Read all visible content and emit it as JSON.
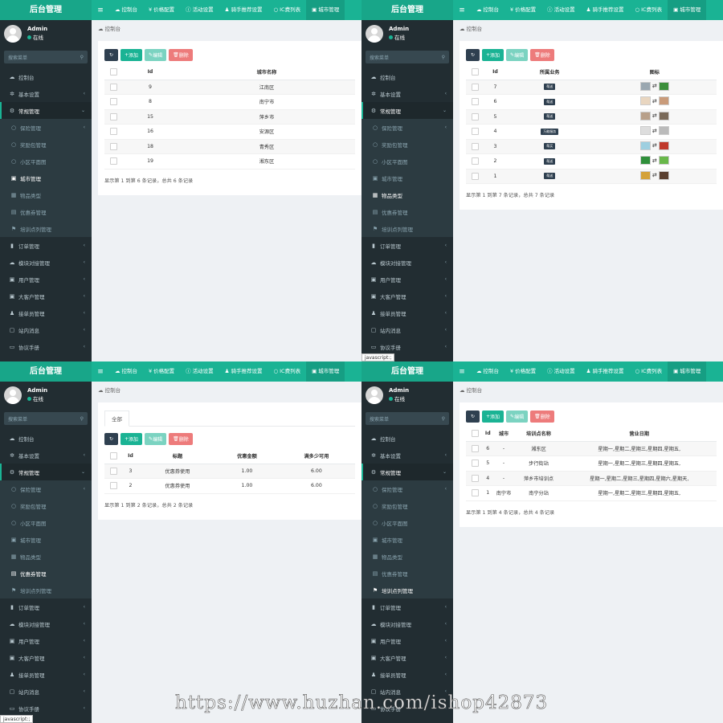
{
  "common": {
    "logo": "后台管理",
    "user_name": "Admin",
    "user_status": "在线",
    "search_placeholder": "搜索菜单",
    "breadcrumb": "控制台",
    "buttons": {
      "add": "添加",
      "edit": "编辑",
      "delete": "删除"
    },
    "status_text": "javascript:;",
    "top_tabs": [
      {
        "label": "控制台",
        "icon": "☁"
      },
      {
        "label": "价格配置",
        "icon": "¥"
      },
      {
        "label": "活动设置",
        "icon": "ⓘ"
      },
      {
        "label": "骑手推荐设置",
        "icon": "♟"
      },
      {
        "label": "IC费列表",
        "icon": "○"
      },
      {
        "label": "城市管理",
        "icon": "▣"
      }
    ],
    "menu": [
      {
        "label": "控制台",
        "icon": "☁",
        "arrow": ""
      },
      {
        "label": "基本设置",
        "icon": "✲",
        "arrow": "‹"
      },
      {
        "label": "常规管理",
        "icon": "⚙",
        "arrow": "⌄"
      },
      {
        "label": "保险管理",
        "icon": "○",
        "arrow": "‹"
      },
      {
        "label": "奖励包管理",
        "icon": "○",
        "arrow": ""
      },
      {
        "label": "小区平面图",
        "icon": "○",
        "arrow": ""
      },
      {
        "label": "城市管理",
        "icon": "▣",
        "arrow": ""
      },
      {
        "label": "物品类型",
        "icon": "▦",
        "arrow": ""
      },
      {
        "label": "优惠券管理",
        "icon": "▤",
        "arrow": ""
      },
      {
        "label": "培训点列管理",
        "icon": "⚑",
        "arrow": ""
      },
      {
        "label": "订单管理",
        "icon": "▮",
        "arrow": "‹"
      },
      {
        "label": "模块对接管理",
        "icon": "☁",
        "arrow": "‹"
      },
      {
        "label": "用户管理",
        "icon": "▣",
        "arrow": "‹"
      },
      {
        "label": "大客户管理",
        "icon": "▣",
        "arrow": "‹"
      },
      {
        "label": "接单员管理",
        "icon": "♟",
        "arrow": "‹"
      },
      {
        "label": "站内消息",
        "icon": "▢",
        "arrow": "‹"
      },
      {
        "label": "协议手册",
        "icon": "▭",
        "arrow": "‹"
      }
    ]
  },
  "screens": [
    {
      "active_menu": "城市管理",
      "columns": [
        "Id",
        "城市名称"
      ],
      "rows": [
        [
          "9",
          "江南区"
        ],
        [
          "8",
          "南宁市"
        ],
        [
          "15",
          "萍乡市"
        ],
        [
          "16",
          "安源区"
        ],
        [
          "18",
          "青秀区"
        ],
        [
          "19",
          "湘东区"
        ]
      ],
      "pager": "显示第 1 到第 6 条记录，总共 6 条记录"
    },
    {
      "active_menu": "物品类型",
      "columns": [
        "Id",
        "所属业务",
        "图标"
      ],
      "rows": [
        [
          "7",
          "帮送"
        ],
        [
          "6",
          "帮送"
        ],
        [
          "5",
          "帮送"
        ],
        [
          "4",
          "万能服务"
        ],
        [
          "3",
          "帮买"
        ],
        [
          "2",
          "帮送"
        ],
        [
          "1",
          "帮送"
        ]
      ],
      "pager": "显示第 1 到第 7 条记录，总共 7 条记录"
    },
    {
      "active_menu": "优惠券管理",
      "filter_tab": "全部",
      "columns": [
        "Id",
        "标题",
        "优惠金额",
        "满多少可用"
      ],
      "rows": [
        [
          "3",
          "优惠券使用",
          "1.00",
          "6.00"
        ],
        [
          "2",
          "优惠券使用",
          "1.00",
          "6.00"
        ]
      ],
      "pager": "显示第 1 到第 2 条记录，总共 2 条记录"
    },
    {
      "active_menu": "培训点列管理",
      "columns": [
        "Id",
        "城市",
        "培训点名称",
        "营业日期"
      ],
      "rows": [
        [
          "6",
          "-",
          "湘东区",
          "星期一,星期二,星期三,星期四,星期五,"
        ],
        [
          "5",
          "-",
          "步行街站",
          "星期一,星期二,星期三,星期四,星期五,"
        ],
        [
          "4",
          "-",
          "萍乡市培训点",
          "星期一,星期二,星期三,星期四,星期六,星期天,"
        ],
        [
          "1",
          "南宁市",
          "南宁分站",
          "星期一,星期二,星期三,星期四,星期五,"
        ]
      ],
      "pager": "显示第 1 到第 4 条记录，总共 4 条记录"
    }
  ],
  "watermark": "https://www.huzhan.com/ishop42873"
}
